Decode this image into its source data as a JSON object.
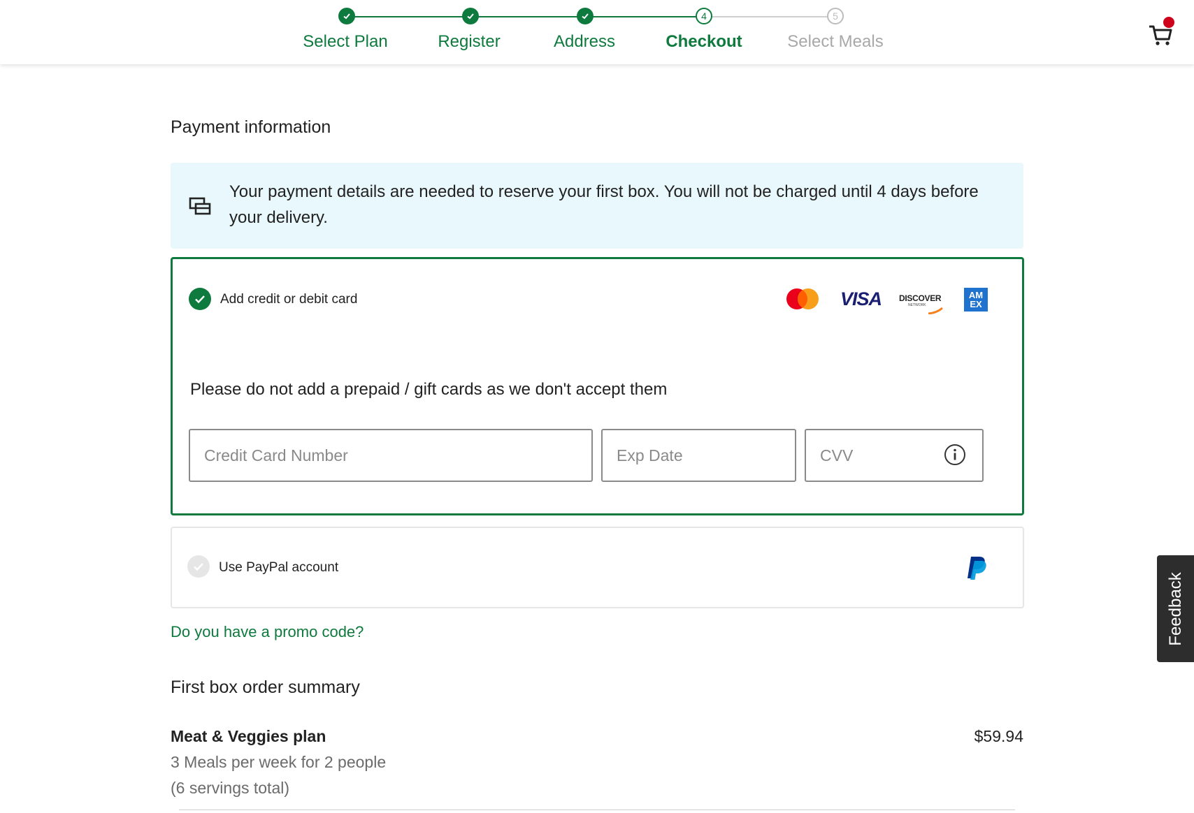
{
  "stepper": {
    "steps": [
      {
        "label": "Select Plan",
        "state": "done",
        "marker": "✓"
      },
      {
        "label": "Register",
        "state": "done",
        "marker": "✓"
      },
      {
        "label": "Address",
        "state": "done",
        "marker": "✓"
      },
      {
        "label": "Checkout",
        "state": "current",
        "marker": "4"
      },
      {
        "label": "Select Meals",
        "state": "future",
        "marker": "5"
      }
    ]
  },
  "header": {
    "cart_icon": "cart-icon",
    "cart_badge_color": "#d0021b"
  },
  "payment": {
    "title": "Payment information",
    "notice": "Your payment details are needed to reserve your first box. You will not be charged until 4 days before your delivery.",
    "notice_icon": "credit-cards-icon",
    "card_option": {
      "label": "Add credit or debit card",
      "selected": true,
      "brands": [
        "mastercard",
        "VISA",
        "DISCOVER",
        "AM EX"
      ],
      "discover_sub": "NETWORK",
      "amex_line1": "AM",
      "amex_line2": "EX",
      "warning": "Please do not add a prepaid / gift cards as we don't accept them",
      "card_number_placeholder": "Credit Card Number",
      "exp_date_placeholder": "Exp Date",
      "cvv_placeholder": "CVV"
    },
    "paypal_option": {
      "label": "Use PayPal account",
      "selected": false
    }
  },
  "promo_link": "Do you have a promo code?",
  "summary": {
    "title": "First box order summary",
    "plan_name": "Meat & Veggies plan",
    "price": "$59.94",
    "detail_line1": "3 Meals per week for 2 people",
    "detail_line2": "(6 servings total)"
  },
  "feedback_tab": "Feedback",
  "colors": {
    "accent": "#0e7a3e",
    "info_bg": "#e8f8fc",
    "muted": "#a8a8a8"
  }
}
